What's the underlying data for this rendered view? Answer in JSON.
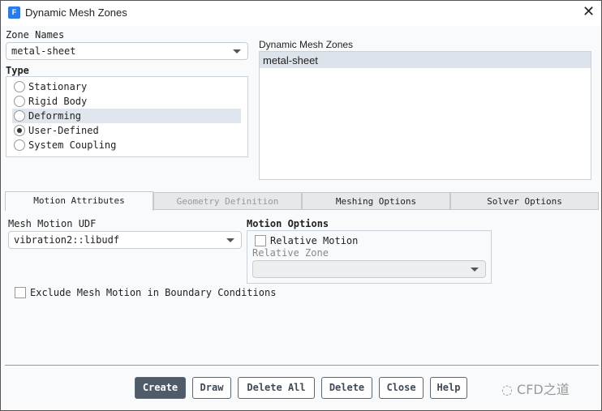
{
  "window": {
    "title": "Dynamic Mesh Zones",
    "logo": "F"
  },
  "zone_names": {
    "label": "Zone Names",
    "value": "metal-sheet"
  },
  "type": {
    "label": "Type",
    "options": [
      "Stationary",
      "Rigid Body",
      "Deforming",
      "User-Defined",
      "System Coupling"
    ],
    "selected": "User-Defined",
    "highlighted": "Deforming"
  },
  "dynamic_zones": {
    "label": "Dynamic Mesh Zones",
    "items": [
      "metal-sheet"
    ]
  },
  "tabs": [
    "Motion Attributes",
    "Geometry Definition",
    "Meshing Options",
    "Solver Options"
  ],
  "motion": {
    "udf_label": "Mesh Motion UDF",
    "udf_value": "vibration2::libudf",
    "options_label": "Motion Options",
    "relative_motion": "Relative Motion",
    "relative_zone": "Relative Zone",
    "exclude": "Exclude Mesh Motion in Boundary Conditions"
  },
  "buttons": [
    "Create",
    "Draw",
    "Delete All",
    "Delete",
    "Close",
    "Help"
  ],
  "watermark": "CFD之道"
}
